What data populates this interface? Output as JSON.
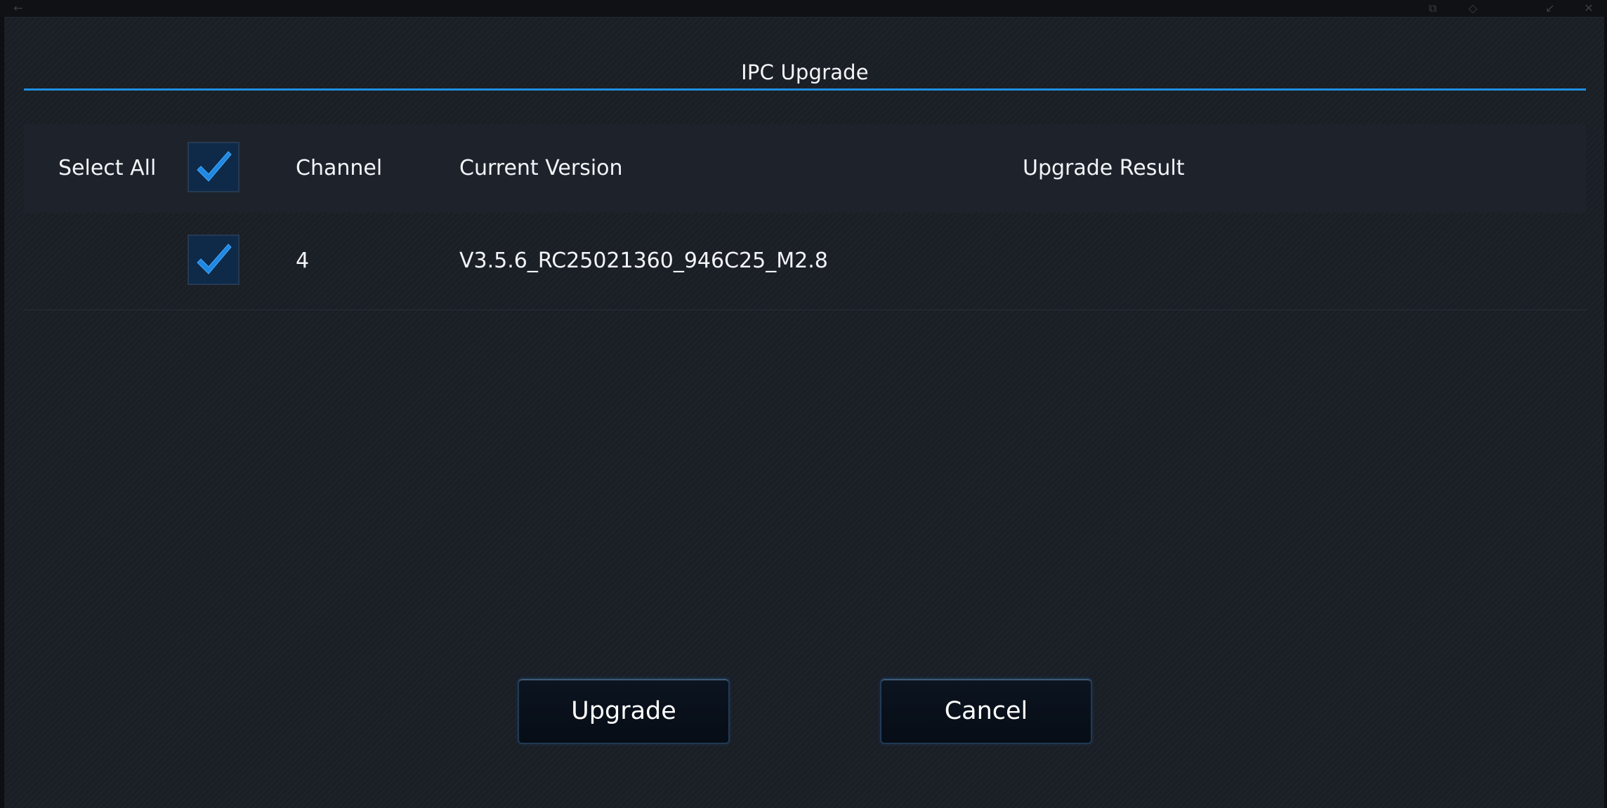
{
  "dialog": {
    "title": "IPC Upgrade"
  },
  "table": {
    "headers": {
      "select_all": "Select All",
      "channel": "Channel",
      "current_version": "Current Version",
      "upgrade_result": "Upgrade Result"
    },
    "select_all_checked": true,
    "rows": [
      {
        "checked": true,
        "channel": "4",
        "current_version": "V3.5.6_RC25021360_946C25_M2.8",
        "upgrade_result": ""
      }
    ]
  },
  "buttons": {
    "upgrade": "Upgrade",
    "cancel": "Cancel"
  },
  "colors": {
    "accent": "#1f8fe0",
    "checkmark": "#1e88e5",
    "background": "#1a1e25"
  },
  "titlebar": {
    "icons": [
      "back-arrow-icon",
      "restore-icon",
      "pin-icon",
      "minimize-icon",
      "close-icon"
    ]
  }
}
